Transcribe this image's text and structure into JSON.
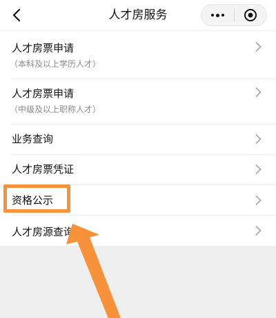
{
  "navbar": {
    "title": "人才房服务",
    "back_icon": "chevron-left-icon",
    "menu_icon": "more-dots-icon",
    "close_icon": "target-circle-icon"
  },
  "list": {
    "items": [
      {
        "label": "人才房票申请",
        "sub": "（本科及以上学历人才）"
      },
      {
        "label": "人才房票申请",
        "sub": "（中级及以上职称人才）"
      },
      {
        "label": "业务查询"
      },
      {
        "label": "人才房票凭证"
      },
      {
        "label": "资格公示"
      },
      {
        "label": "人才房源查询"
      }
    ]
  },
  "annotation": {
    "highlight_color": "#f7923a",
    "arrow_color": "#f7923a"
  },
  "colors": {
    "background": "#efefef",
    "surface": "#ffffff",
    "text": "#111111",
    "subtext": "#8a8a8a"
  }
}
